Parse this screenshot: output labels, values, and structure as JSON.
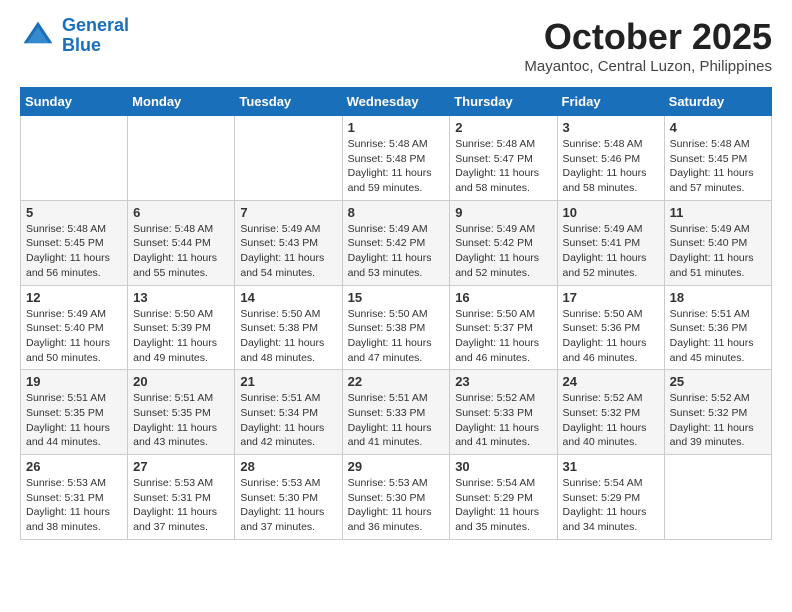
{
  "logo": {
    "line1": "General",
    "line2": "Blue"
  },
  "title": "October 2025",
  "location": "Mayantoc, Central Luzon, Philippines",
  "weekdays": [
    "Sunday",
    "Monday",
    "Tuesday",
    "Wednesday",
    "Thursday",
    "Friday",
    "Saturday"
  ],
  "weeks": [
    [
      {
        "day": "",
        "sunrise": "",
        "sunset": "",
        "daylight": ""
      },
      {
        "day": "",
        "sunrise": "",
        "sunset": "",
        "daylight": ""
      },
      {
        "day": "",
        "sunrise": "",
        "sunset": "",
        "daylight": ""
      },
      {
        "day": "1",
        "sunrise": "Sunrise: 5:48 AM",
        "sunset": "Sunset: 5:48 PM",
        "daylight": "Daylight: 11 hours and 59 minutes."
      },
      {
        "day": "2",
        "sunrise": "Sunrise: 5:48 AM",
        "sunset": "Sunset: 5:47 PM",
        "daylight": "Daylight: 11 hours and 58 minutes."
      },
      {
        "day": "3",
        "sunrise": "Sunrise: 5:48 AM",
        "sunset": "Sunset: 5:46 PM",
        "daylight": "Daylight: 11 hours and 58 minutes."
      },
      {
        "day": "4",
        "sunrise": "Sunrise: 5:48 AM",
        "sunset": "Sunset: 5:45 PM",
        "daylight": "Daylight: 11 hours and 57 minutes."
      }
    ],
    [
      {
        "day": "5",
        "sunrise": "Sunrise: 5:48 AM",
        "sunset": "Sunset: 5:45 PM",
        "daylight": "Daylight: 11 hours and 56 minutes."
      },
      {
        "day": "6",
        "sunrise": "Sunrise: 5:48 AM",
        "sunset": "Sunset: 5:44 PM",
        "daylight": "Daylight: 11 hours and 55 minutes."
      },
      {
        "day": "7",
        "sunrise": "Sunrise: 5:49 AM",
        "sunset": "Sunset: 5:43 PM",
        "daylight": "Daylight: 11 hours and 54 minutes."
      },
      {
        "day": "8",
        "sunrise": "Sunrise: 5:49 AM",
        "sunset": "Sunset: 5:42 PM",
        "daylight": "Daylight: 11 hours and 53 minutes."
      },
      {
        "day": "9",
        "sunrise": "Sunrise: 5:49 AM",
        "sunset": "Sunset: 5:42 PM",
        "daylight": "Daylight: 11 hours and 52 minutes."
      },
      {
        "day": "10",
        "sunrise": "Sunrise: 5:49 AM",
        "sunset": "Sunset: 5:41 PM",
        "daylight": "Daylight: 11 hours and 52 minutes."
      },
      {
        "day": "11",
        "sunrise": "Sunrise: 5:49 AM",
        "sunset": "Sunset: 5:40 PM",
        "daylight": "Daylight: 11 hours and 51 minutes."
      }
    ],
    [
      {
        "day": "12",
        "sunrise": "Sunrise: 5:49 AM",
        "sunset": "Sunset: 5:40 PM",
        "daylight": "Daylight: 11 hours and 50 minutes."
      },
      {
        "day": "13",
        "sunrise": "Sunrise: 5:50 AM",
        "sunset": "Sunset: 5:39 PM",
        "daylight": "Daylight: 11 hours and 49 minutes."
      },
      {
        "day": "14",
        "sunrise": "Sunrise: 5:50 AM",
        "sunset": "Sunset: 5:38 PM",
        "daylight": "Daylight: 11 hours and 48 minutes."
      },
      {
        "day": "15",
        "sunrise": "Sunrise: 5:50 AM",
        "sunset": "Sunset: 5:38 PM",
        "daylight": "Daylight: 11 hours and 47 minutes."
      },
      {
        "day": "16",
        "sunrise": "Sunrise: 5:50 AM",
        "sunset": "Sunset: 5:37 PM",
        "daylight": "Daylight: 11 hours and 46 minutes."
      },
      {
        "day": "17",
        "sunrise": "Sunrise: 5:50 AM",
        "sunset": "Sunset: 5:36 PM",
        "daylight": "Daylight: 11 hours and 46 minutes."
      },
      {
        "day": "18",
        "sunrise": "Sunrise: 5:51 AM",
        "sunset": "Sunset: 5:36 PM",
        "daylight": "Daylight: 11 hours and 45 minutes."
      }
    ],
    [
      {
        "day": "19",
        "sunrise": "Sunrise: 5:51 AM",
        "sunset": "Sunset: 5:35 PM",
        "daylight": "Daylight: 11 hours and 44 minutes."
      },
      {
        "day": "20",
        "sunrise": "Sunrise: 5:51 AM",
        "sunset": "Sunset: 5:35 PM",
        "daylight": "Daylight: 11 hours and 43 minutes."
      },
      {
        "day": "21",
        "sunrise": "Sunrise: 5:51 AM",
        "sunset": "Sunset: 5:34 PM",
        "daylight": "Daylight: 11 hours and 42 minutes."
      },
      {
        "day": "22",
        "sunrise": "Sunrise: 5:51 AM",
        "sunset": "Sunset: 5:33 PM",
        "daylight": "Daylight: 11 hours and 41 minutes."
      },
      {
        "day": "23",
        "sunrise": "Sunrise: 5:52 AM",
        "sunset": "Sunset: 5:33 PM",
        "daylight": "Daylight: 11 hours and 41 minutes."
      },
      {
        "day": "24",
        "sunrise": "Sunrise: 5:52 AM",
        "sunset": "Sunset: 5:32 PM",
        "daylight": "Daylight: 11 hours and 40 minutes."
      },
      {
        "day": "25",
        "sunrise": "Sunrise: 5:52 AM",
        "sunset": "Sunset: 5:32 PM",
        "daylight": "Daylight: 11 hours and 39 minutes."
      }
    ],
    [
      {
        "day": "26",
        "sunrise": "Sunrise: 5:53 AM",
        "sunset": "Sunset: 5:31 PM",
        "daylight": "Daylight: 11 hours and 38 minutes."
      },
      {
        "day": "27",
        "sunrise": "Sunrise: 5:53 AM",
        "sunset": "Sunset: 5:31 PM",
        "daylight": "Daylight: 11 hours and 37 minutes."
      },
      {
        "day": "28",
        "sunrise": "Sunrise: 5:53 AM",
        "sunset": "Sunset: 5:30 PM",
        "daylight": "Daylight: 11 hours and 37 minutes."
      },
      {
        "day": "29",
        "sunrise": "Sunrise: 5:53 AM",
        "sunset": "Sunset: 5:30 PM",
        "daylight": "Daylight: 11 hours and 36 minutes."
      },
      {
        "day": "30",
        "sunrise": "Sunrise: 5:54 AM",
        "sunset": "Sunset: 5:29 PM",
        "daylight": "Daylight: 11 hours and 35 minutes."
      },
      {
        "day": "31",
        "sunrise": "Sunrise: 5:54 AM",
        "sunset": "Sunset: 5:29 PM",
        "daylight": "Daylight: 11 hours and 34 minutes."
      },
      {
        "day": "",
        "sunrise": "",
        "sunset": "",
        "daylight": ""
      }
    ]
  ]
}
